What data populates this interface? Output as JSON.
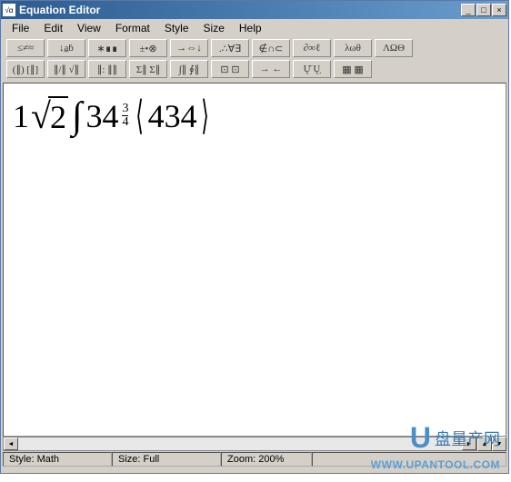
{
  "window": {
    "title": "Equation Editor"
  },
  "menu": [
    "File",
    "Edit",
    "View",
    "Format",
    "Style",
    "Size",
    "Help"
  ],
  "toolbar": {
    "row1": [
      "≤≠≈",
      "↓a̲ḃ",
      "∗∎∎",
      "±•⊗",
      "→⇔↓",
      ".∴∀∃",
      "∉∩⊂",
      "∂∞ℓ",
      "λωθ",
      "ΛΩΘ"
    ],
    "row2": [
      "(∥) [∥]",
      "∥/∥ √∥",
      "∥: ∥∥",
      "Σ∥ Σ∥",
      "∫∥ ∮∥",
      "⊡ ⊡",
      "→ ←",
      "Ų̄ Ų̣",
      "▦ ▦"
    ]
  },
  "equation": {
    "lead": "1",
    "sqrt_arg": "2",
    "after_sqrt": "34",
    "frac_num": "3",
    "frac_den": "4",
    "angle_content": "434"
  },
  "status": {
    "style_label": "Style:",
    "style_value": "Math",
    "size_label": "Size:",
    "size_value": "Full",
    "zoom_label": "Zoom:",
    "zoom_value": "200%"
  },
  "watermark": {
    "line1": "盘量产网",
    "line2": "WWW.UPANTOOL.COM"
  }
}
